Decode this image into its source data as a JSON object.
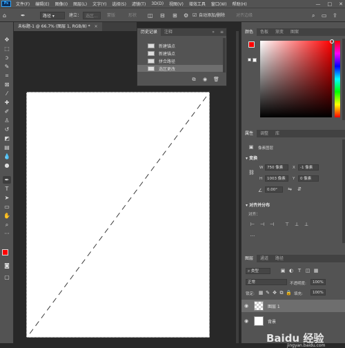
{
  "app": {
    "logo_text": "Ps"
  },
  "menu": [
    "文件(F)",
    "编辑(E)",
    "图像(I)",
    "图层(L)",
    "文字(Y)",
    "选择(S)",
    "滤镜(T)",
    "3D(D)",
    "视图(V)",
    "增效工具",
    "窗口(W)",
    "帮助(H)"
  ],
  "window_controls": [
    "—",
    "□",
    "✕"
  ],
  "options": {
    "mode_value": "路径",
    "create_label": "建立：",
    "selection_btn": "选区...",
    "mask_btn": "蒙版",
    "shape_btn": "形状",
    "auto_add_label": "自动添加/删除",
    "align_edges": "对齐边缘"
  },
  "document": {
    "tab_title": "未标题-1 @ 66.7% (图层 1, RGB/8) *"
  },
  "history": {
    "tabs": [
      "历史记录",
      "注释"
    ],
    "items": [
      "新建锚点",
      "新建锚点",
      "拼合路径",
      "选区更改"
    ]
  },
  "color_panel": {
    "tabs": [
      "颜色",
      "色板",
      "渐变",
      "图案"
    ],
    "foreground": "#ff0000",
    "background": "#ffffff"
  },
  "properties": {
    "tabs": [
      "属性",
      "调整",
      "库"
    ],
    "layer_type": "像素图层",
    "transform_label": "变换",
    "w_label": "W",
    "w_value": "750 像素",
    "h_label": "H",
    "h_value": "1003 像素",
    "x_label": "X",
    "x_value": "-1 像素",
    "y_label": "Y",
    "y_value": "0 像素",
    "angle_value": "0.00°",
    "align_label": "对齐并分布",
    "align_sub": "对齐："
  },
  "layers": {
    "tabs": [
      "图层",
      "通道",
      "路径"
    ],
    "filter_kind": "类型",
    "blend_mode": "正常",
    "opacity_label": "不透明度:",
    "opacity_value": "100%",
    "lock_label": "锁定:",
    "fill_label": "填充:",
    "fill_value": "100%",
    "items": [
      {
        "name": "图层 1",
        "selected": true
      },
      {
        "name": "背景",
        "selected": false
      }
    ]
  },
  "watermark": "Baidu 经验",
  "watermark_url": "jingyan.baidu.com"
}
